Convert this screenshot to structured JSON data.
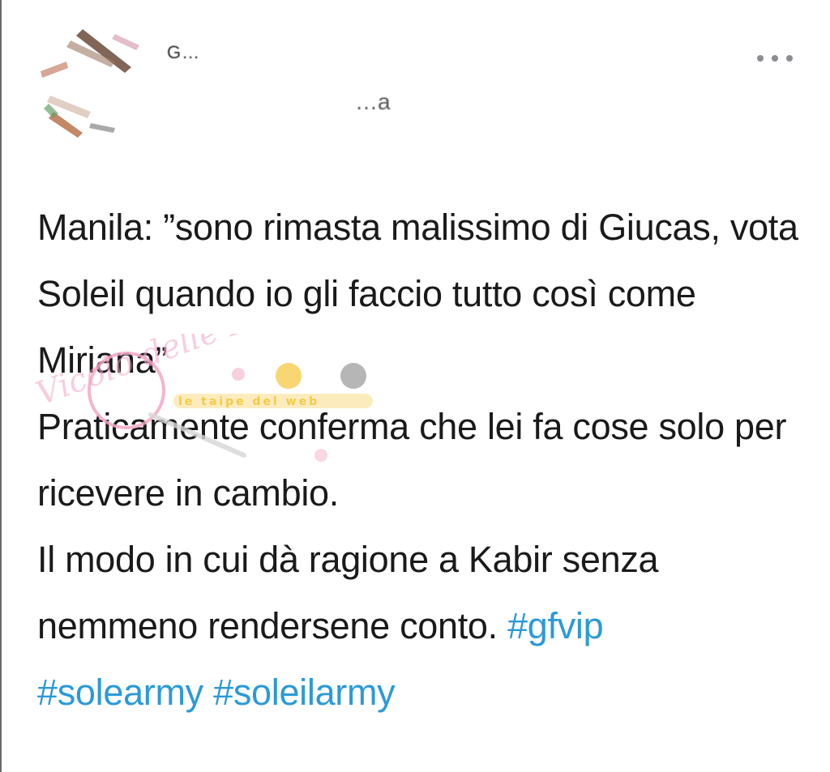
{
  "tweet": {
    "author": {
      "display_name": "G…",
      "handle": "…a"
    },
    "more_menu_icon": "more-horizontal-icon",
    "text": {
      "paragraph_1": "Manila: ”sono rimasta malissimo di Giucas, vota Soleil quando io gli faccio tutto così come Miriana”",
      "paragraph_2": "Praticamente conferma che lei fa cose solo per ricevere in cambio.",
      "paragraph_3": "Il modo in cui dà ragione a Kabir senza nemmeno rendersene conto."
    },
    "hashtags": [
      "#gfvip",
      "#solearmy",
      "#soleilarmy"
    ]
  },
  "watermark": {
    "logo_text": "Vicolo delle News",
    "banner_text": "le taipe del web"
  },
  "colors": {
    "text": "#1a1a1a",
    "hashtag": "#2b9ad8",
    "icon": "#8a8d91",
    "watermark_pink": "#f4a7c6",
    "watermark_yellow": "#f5c842"
  }
}
